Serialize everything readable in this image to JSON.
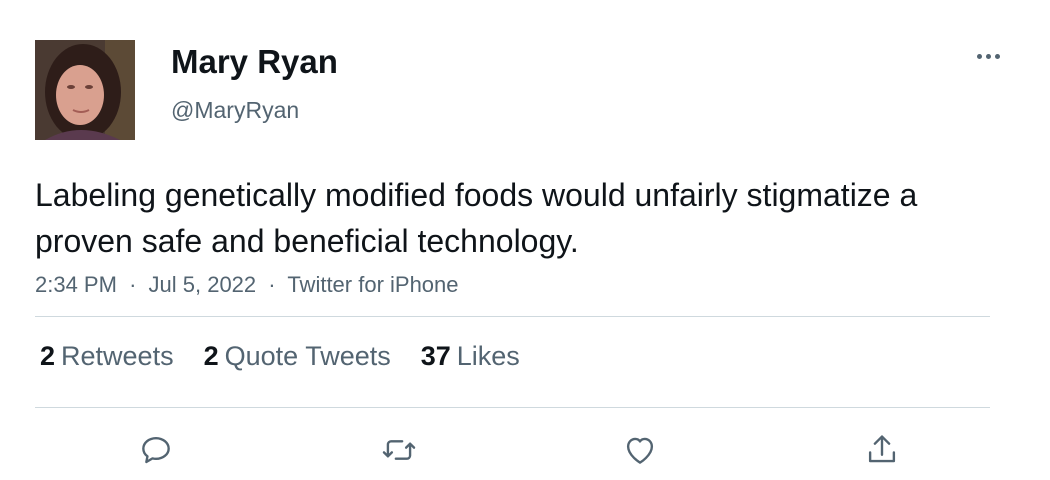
{
  "author": {
    "name": "Mary Ryan",
    "handle": "@MaryRyan"
  },
  "tweet": {
    "text": "Labeling genetically modified foods would unfairly stigmatize a proven safe and beneficial technology.",
    "time": "2:34 PM",
    "date": "Jul 5, 2022",
    "source": "Twitter for iPhone",
    "separator": "·"
  },
  "stats": {
    "retweets": {
      "count": "2",
      "label": "Retweets"
    },
    "quote_tweets": {
      "count": "2",
      "label": "Quote Tweets"
    },
    "likes": {
      "count": "37",
      "label": "Likes"
    }
  },
  "actions": [
    "reply-icon",
    "retweet-icon",
    "like-icon",
    "share-icon"
  ],
  "colors": {
    "text": "#0f1419",
    "secondary": "#536471",
    "divider": "#cfd9de"
  }
}
